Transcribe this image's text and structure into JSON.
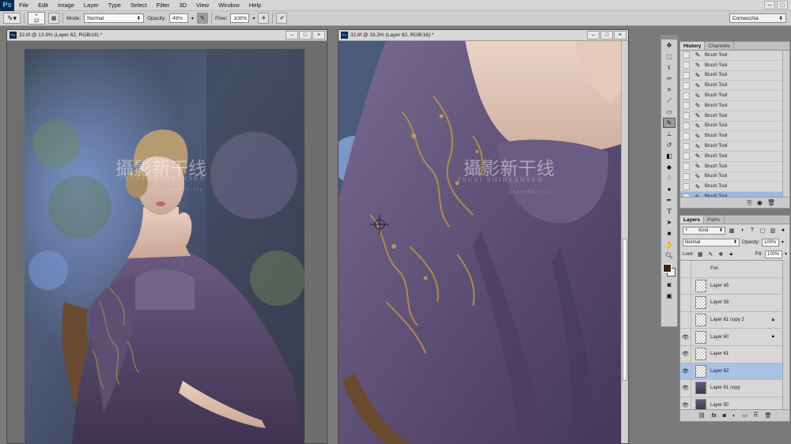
{
  "menu": [
    "File",
    "Edit",
    "Image",
    "Layer",
    "Type",
    "Select",
    "Filter",
    "3D",
    "View",
    "Window",
    "Help"
  ],
  "app_logo": "Ps",
  "window_controls": [
    "–",
    "□"
  ],
  "options": {
    "brush_size": "12",
    "mode_label": "Mode:",
    "mode_value": "Normal",
    "opacity_label": "Opacity:",
    "opacity_value": "49%",
    "flow_label": "Flow:",
    "flow_value": "100%",
    "workspace": "Cornacchia"
  },
  "doc1": {
    "title": "32.tif @ 13.9% (Layer 62, RGB/16) *",
    "icon": "Ps"
  },
  "doc2": {
    "title": "32.tif @ 33.3% (Layer 62, RGB/16) *",
    "icon": "Ps"
  },
  "doc_controls": [
    "–",
    "□",
    "×"
  ],
  "watermark": {
    "main": "攝影新干线",
    "sub": "TSUEI SHINKANSEN",
    "sub2": "photo83.vip"
  },
  "history": {
    "tabs": [
      "History",
      "Channels"
    ],
    "items": [
      "Brush Tool",
      "Brush Tool",
      "Brush Tool",
      "Brush Tool",
      "Brush Tool",
      "Brush Tool",
      "Brush Tool",
      "Brush Tool",
      "Brush Tool",
      "Brush Tool",
      "Brush Tool",
      "Brush Tool",
      "Brush Tool",
      "Brush Tool",
      "Brush Tool"
    ],
    "selected_index": 14
  },
  "layers": {
    "tabs": [
      "Layers",
      "Paths"
    ],
    "kind_label": "Kind",
    "blend_mode": "Normal",
    "opacity_label": "Opacity:",
    "opacity_value": "100%",
    "lock_label": "Lock:",
    "fill_label": "Fill:",
    "fill_value": "100%",
    "items": [
      {
        "name": "Fori",
        "visible": false,
        "thumb": "none",
        "locked": false
      },
      {
        "name": "Layer 45",
        "visible": false,
        "thumb": "empty",
        "locked": false
      },
      {
        "name": "Layer 58",
        "visible": false,
        "thumb": "empty",
        "locked": false
      },
      {
        "name": "Layer 61 copy 2",
        "visible": false,
        "thumb": "empty",
        "locked": true
      },
      {
        "name": "Layer 60",
        "visible": true,
        "thumb": "empty",
        "locked": true
      },
      {
        "name": "Layer 61",
        "visible": true,
        "thumb": "empty",
        "locked": false
      },
      {
        "name": "Layer 62",
        "visible": true,
        "thumb": "empty",
        "locked": false
      },
      {
        "name": "Layer 61 copy",
        "visible": true,
        "thumb": "photo",
        "locked": false
      },
      {
        "name": "Layer 50",
        "visible": true,
        "thumb": "photo",
        "locked": false
      }
    ],
    "selected_index": 6,
    "footer_icons": [
      "link-icon",
      "fx-icon",
      "mask-icon",
      "adjustment-icon",
      "group-icon",
      "new-layer-icon",
      "trash-icon"
    ]
  },
  "colors": {
    "accent_selection": "#9bb9e4",
    "foreground": "#3a2418",
    "background": "#f1f1f1"
  }
}
